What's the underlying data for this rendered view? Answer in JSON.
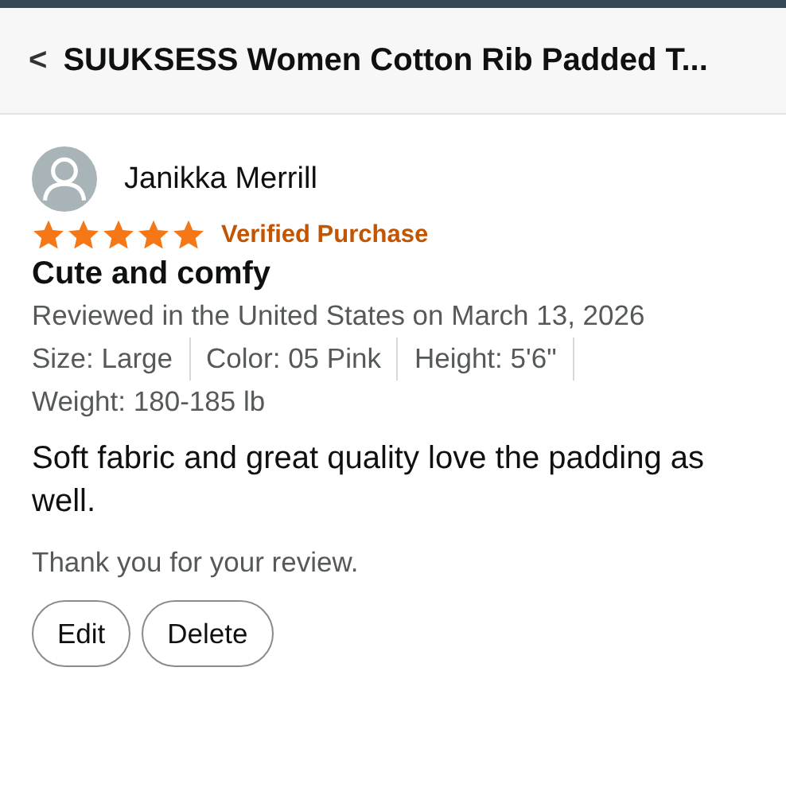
{
  "header": {
    "back_icon": "<",
    "title": "SUUKSESS Women Cotton Rib Padded T..."
  },
  "review": {
    "reviewer": "Janikka Merrill",
    "stars": 5,
    "badge": "Verified Purchase",
    "title": "Cute and comfy",
    "date": "Reviewed in the United States on March 13, 2026",
    "attributes": [
      "Size: Large",
      "Color: 05 Pink",
      "Height: 5'6\"",
      "Weight: 180-185 lb"
    ],
    "body": "Soft fabric and great quality love the padding as well.",
    "thanks": "Thank you for your review.",
    "buttons": [
      "Edit",
      "Delete"
    ]
  }
}
